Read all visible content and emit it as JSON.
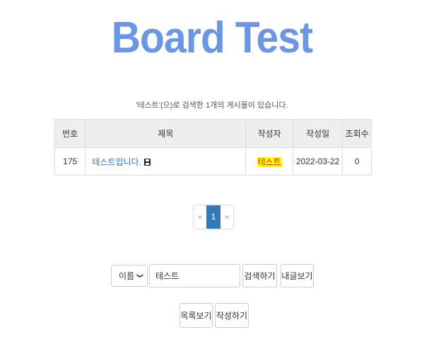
{
  "page": {
    "title": "Board Test",
    "summary": "'테스트'(으)로 검색한 1개의 게시물이 있습니다."
  },
  "table": {
    "headers": {
      "no": "번호",
      "subject": "제목",
      "author": "작성자",
      "date": "작성일",
      "views": "조회수"
    },
    "rows": [
      {
        "no": "175",
        "subject": "테스트입니다.",
        "author": "테스트",
        "date": "2022-03-22",
        "views": "0"
      }
    ]
  },
  "pagination": {
    "prev": "«",
    "current": "1",
    "next": "»"
  },
  "search": {
    "field_selected": "이름",
    "query_value": "테스트",
    "search_button": "검색하기",
    "my_posts_button": "내글보기"
  },
  "actions": {
    "list_button": "목록보기",
    "write_button": "작성하기"
  },
  "colors": {
    "title": "#6a96e3",
    "link": "#337ab7",
    "highlight_bg": "#ffff00",
    "highlight_text": "#e01b1b",
    "active_page": "#337ab7"
  }
}
